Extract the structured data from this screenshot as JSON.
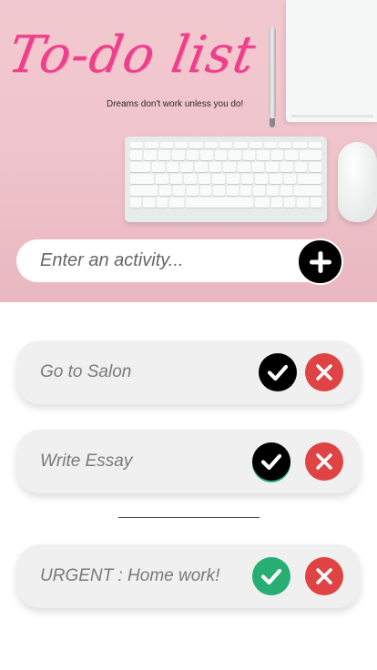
{
  "header": {
    "title": "To-do list",
    "subtitle": "Dreams don't work unless you do!"
  },
  "input": {
    "placeholder": "Enter an activity..."
  },
  "add_button": {
    "icon": "plus-icon"
  },
  "todos": [
    {
      "text": "Go to Salon",
      "done": false,
      "check_color": "#000000"
    },
    {
      "text": "Write Essay",
      "done": false,
      "check_color": "#000000"
    },
    {
      "text": "URGENT : Home work!",
      "done": true,
      "check_color": "#27ae73"
    }
  ],
  "colors": {
    "title_pink": "#ef3f8c",
    "hero_bg": "#f3c9d0",
    "delete_red": "#e04343",
    "done_green": "#27ae73"
  }
}
